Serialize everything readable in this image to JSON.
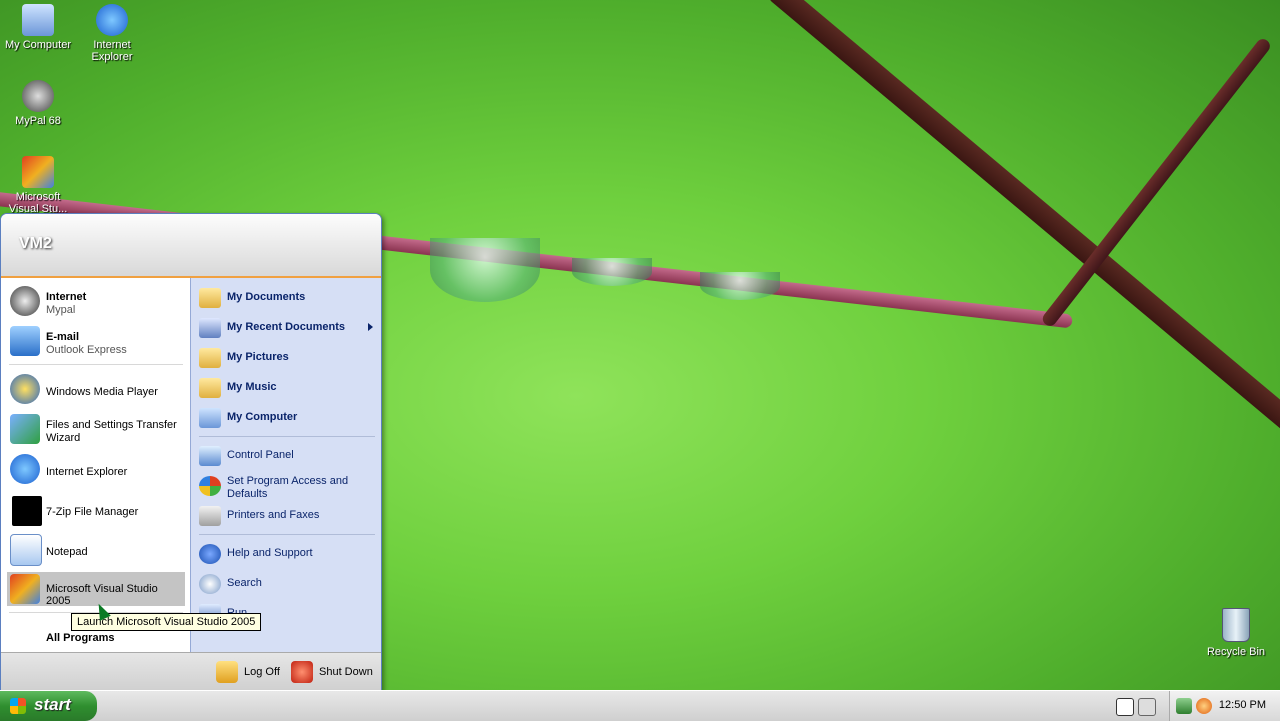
{
  "desktop": {
    "icons": [
      {
        "label": "My Computer"
      },
      {
        "label": "Internet Explorer"
      },
      {
        "label": "MyPal 68"
      },
      {
        "label": "Microsoft Visual Stu..."
      }
    ],
    "recycle_bin": "Recycle Bin"
  },
  "start_menu": {
    "user": "VM2",
    "pinned": [
      {
        "title": "Internet",
        "subtitle": "Mypal"
      },
      {
        "title": "E-mail",
        "subtitle": "Outlook Express"
      }
    ],
    "recent": [
      {
        "label": "Windows Media Player"
      },
      {
        "label": "Files and Settings Transfer Wizard"
      },
      {
        "label": "Internet Explorer"
      },
      {
        "label": "7-Zip File Manager"
      },
      {
        "label": "Notepad"
      },
      {
        "label": "Microsoft Visual Studio 2005"
      }
    ],
    "all_programs": "All Programs",
    "places": [
      {
        "label": "My Documents"
      },
      {
        "label": "My Recent Documents"
      },
      {
        "label": "My Pictures"
      },
      {
        "label": "My Music"
      },
      {
        "label": "My Computer"
      }
    ],
    "settings": [
      {
        "label": "Control Panel"
      },
      {
        "label": "Set Program Access and Defaults"
      },
      {
        "label": "Printers and Faxes"
      }
    ],
    "help": [
      {
        "label": "Help and Support"
      },
      {
        "label": "Search"
      },
      {
        "label": "Run..."
      }
    ],
    "log_off": "Log Off",
    "shut_down": "Shut Down"
  },
  "tooltip": "Launch Microsoft Visual Studio 2005",
  "taskbar": {
    "start_label": "start",
    "clock": "12:50 PM"
  },
  "colors": {
    "wallpaper_green": "#6fd03e",
    "start_green": "#2f8f2f",
    "places_bg": "#d6dff5",
    "tooltip_bg": "#ffffe1"
  }
}
